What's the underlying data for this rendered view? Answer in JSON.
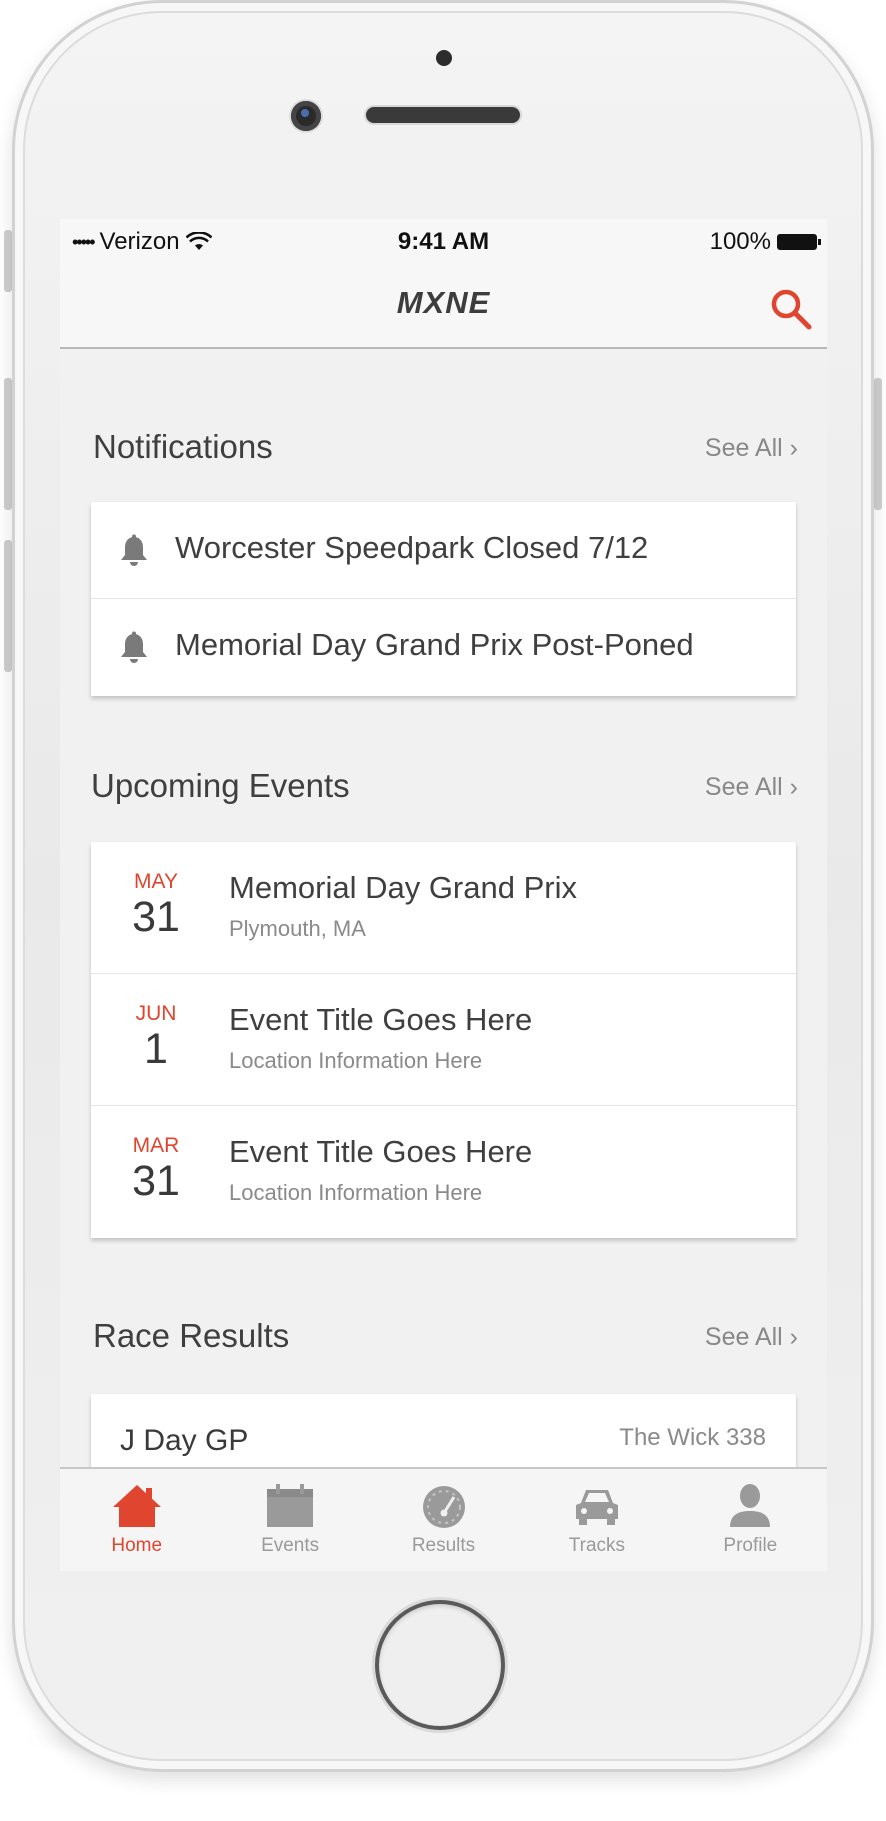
{
  "colors": {
    "accent": "#e0452f",
    "screen_bg": "#f1f1f1",
    "card_bg": "#ffffff",
    "inactive": "#9a9a9a"
  },
  "status_bar": {
    "carrier": "Verizon",
    "signal": "•••••",
    "time": "9:41 AM",
    "battery": "100%"
  },
  "nav": {
    "title": "MXNE",
    "search_icon": "search-icon"
  },
  "notifications": {
    "title": "Notifications",
    "see_all": "See All ›",
    "items": [
      {
        "icon": "bell-icon",
        "text": "Worcester Speedpark Closed 7/12"
      },
      {
        "icon": "bell-icon",
        "text": "Memorial Day Grand Prix Post-Poned"
      }
    ]
  },
  "upcoming_events": {
    "title": "Upcoming Events",
    "see_all": "See All ›",
    "items": [
      {
        "month": "MAY",
        "day": "31",
        "title": "Memorial Day Grand Prix",
        "location": "Plymouth, MA"
      },
      {
        "month": "JUN",
        "day": "1",
        "title": "Event Title Goes Here",
        "location": "Location Information Here"
      },
      {
        "month": "MAR",
        "day": "31",
        "title": "Event Title Goes Here",
        "location": "Location Information Here"
      }
    ]
  },
  "race_results": {
    "title": "Race Results",
    "see_all": "See All ›",
    "items": [
      {
        "name": "J Day GP",
        "track": "The Wick 338"
      }
    ]
  },
  "tab_bar": {
    "tabs": [
      {
        "label": "Home",
        "icon": "home-icon",
        "active": true
      },
      {
        "label": "Events",
        "icon": "calendar-icon",
        "active": false
      },
      {
        "label": "Results",
        "icon": "speedometer-icon",
        "active": false
      },
      {
        "label": "Tracks",
        "icon": "car-icon",
        "active": false
      },
      {
        "label": "Profile",
        "icon": "person-icon",
        "active": false
      }
    ]
  }
}
